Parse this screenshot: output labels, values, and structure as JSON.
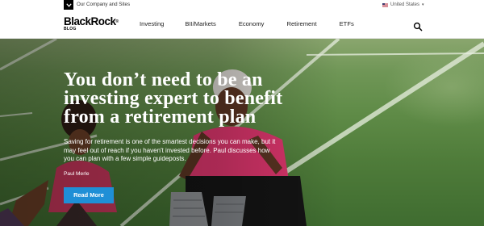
{
  "topbar": {
    "company_label": "Our Company and Sites",
    "region_label": "United States",
    "toggle_icon": "chevron-down-icon"
  },
  "nav": {
    "logo_main": "BlackRock",
    "logo_sub": "BLOG",
    "links": [
      "Investing",
      "BII/Markets",
      "Economy",
      "Retirement",
      "ETFs"
    ],
    "search_icon": "search-icon"
  },
  "hero": {
    "headline": "You don’t need to be an investing expert to benefit from a retirement plan",
    "subtext": "Saving for retirement is one of the smartest decisions you can make, but it may feel out of reach if you haven't invested before. Paul discusses how you can plan with a few simple guideposts.",
    "author": "Paul Merle",
    "cta_label": "Read More",
    "cta_color": "#1f8fd6"
  }
}
